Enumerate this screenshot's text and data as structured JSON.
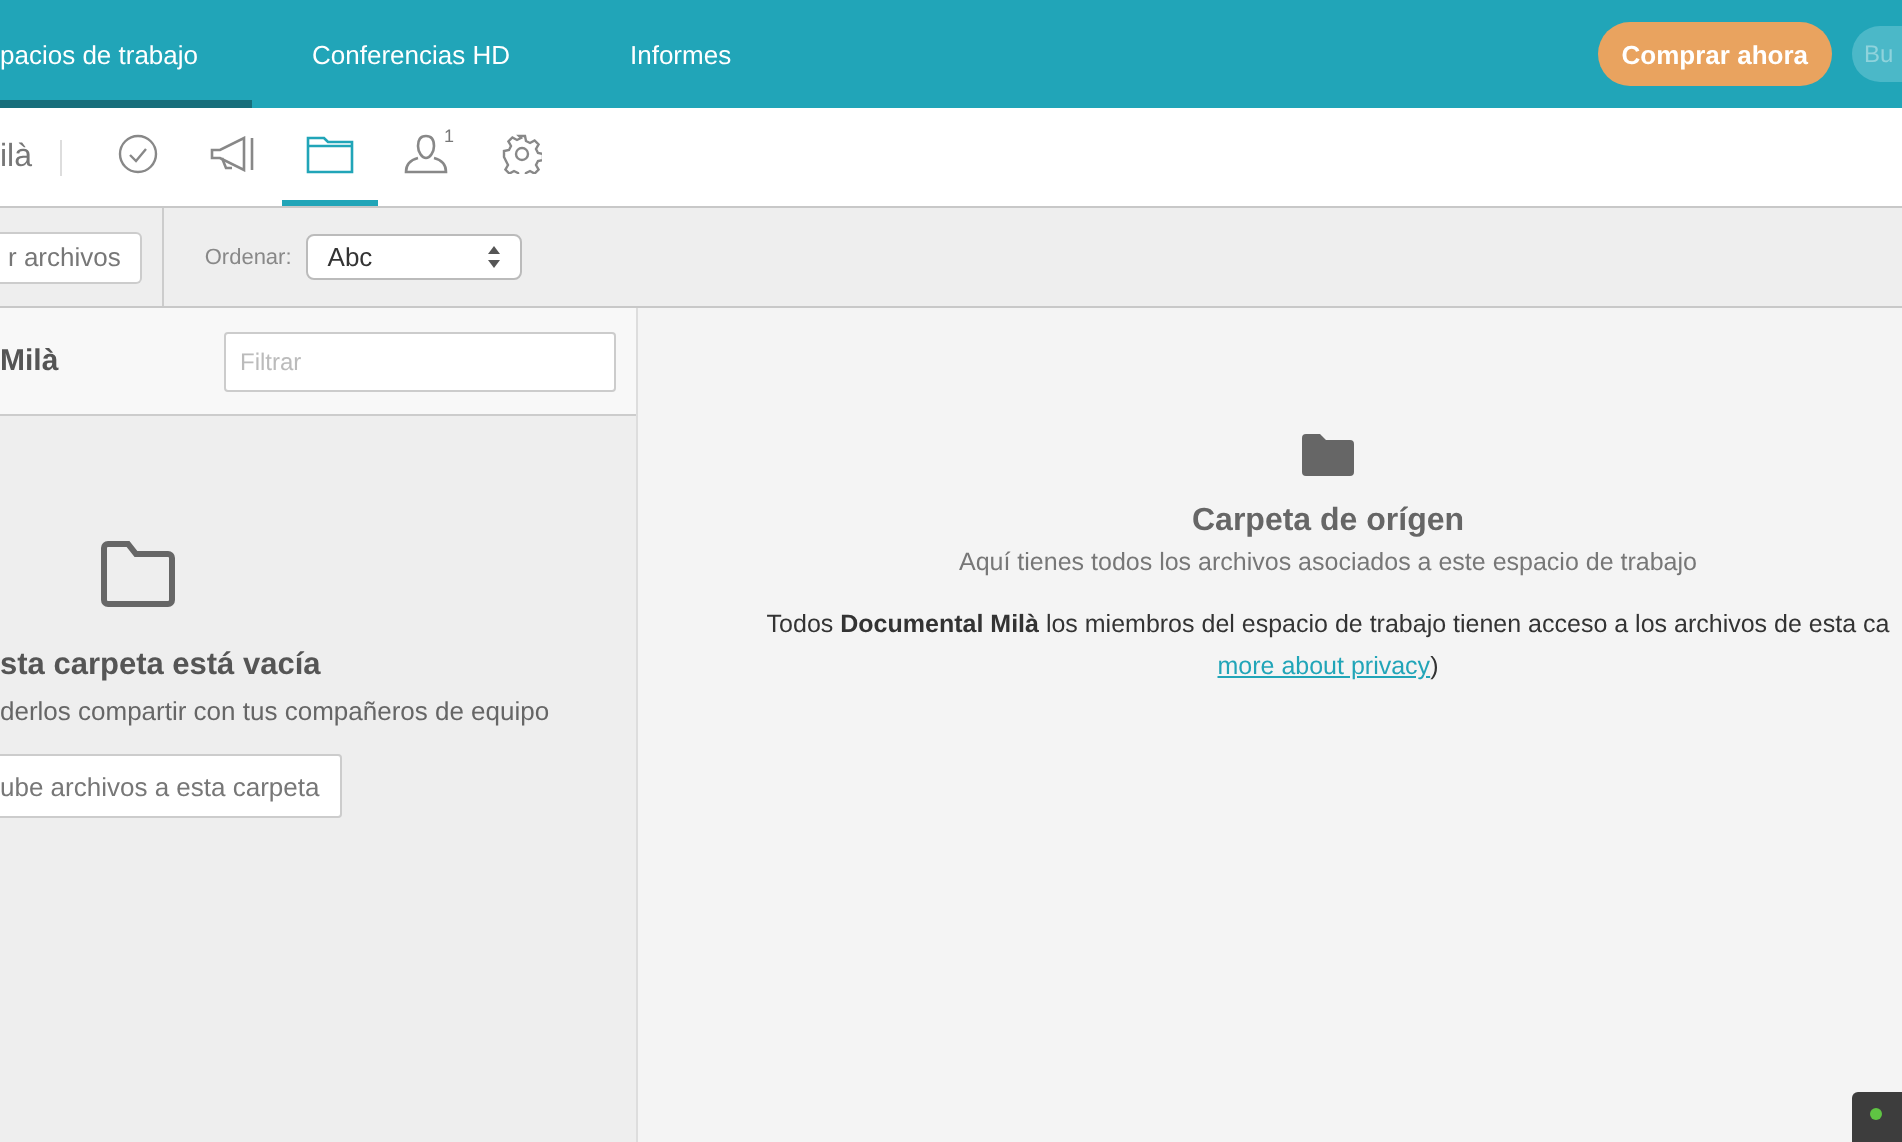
{
  "top_nav": {
    "tabs": [
      {
        "label": "pacios de trabajo",
        "selected": true
      },
      {
        "label": "Conferencias HD",
        "selected": false
      },
      {
        "label": "Informes",
        "selected": false
      }
    ],
    "buy_button": "Comprar ahora",
    "search_button": "Bu"
  },
  "sub_nav": {
    "workspace_name": "ilà",
    "items": [
      {
        "kind": "check",
        "selected": false
      },
      {
        "kind": "megaphone",
        "selected": false
      },
      {
        "kind": "folder",
        "selected": true
      },
      {
        "kind": "user",
        "selected": false,
        "badge": "1"
      },
      {
        "kind": "gear",
        "selected": false
      }
    ]
  },
  "toolbar": {
    "upload_button": "r archivos",
    "sort_label": "Ordenar:",
    "sort_value": "Abc"
  },
  "folder_panel": {
    "title": "Milà",
    "filter_placeholder": "Filtrar",
    "empty_title": "sta carpeta está vacía",
    "empty_text": "derlos compartir con tus compañeros de equipo",
    "upload_button": "ube archivos a esta carpeta"
  },
  "details": {
    "title": "Carpeta de orígen",
    "subtitle": "Aquí tienes todos los archivos asociados a este espacio de trabajo",
    "note": "Todos **Documental Milà** los miembros del espacio de trabajo tienen acceso a los archivos de esta ca",
    "link": "more about privacy",
    "note_end": ")"
  }
}
